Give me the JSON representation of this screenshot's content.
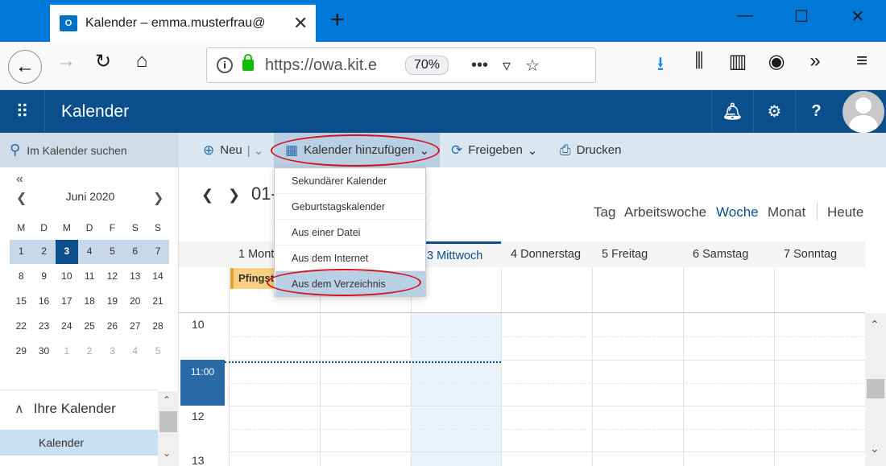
{
  "browser": {
    "tab_title": "Kalender – emma.musterfrau@",
    "favicon_text": "O",
    "url": "https://owa.kit.e",
    "zoom": "70%"
  },
  "app": {
    "title": "Kalender",
    "search_placeholder": "Im Kalender suchen"
  },
  "toolbar": {
    "new_label": "Neu",
    "add_calendar_label": "Kalender hinzufügen",
    "share_label": "Freigeben",
    "print_label": "Drucken"
  },
  "dropdown": {
    "items": [
      "Sekundärer Kalender",
      "Geburtstagskalender",
      "Aus einer Datei",
      "Aus dem Internet",
      "Aus dem Verzeichnis"
    ]
  },
  "mini_calendar": {
    "month": "Juni 2020",
    "weekday_headers": [
      "M",
      "D",
      "M",
      "D",
      "F",
      "S",
      "S"
    ],
    "rows": [
      [
        "1",
        "2",
        "3",
        "4",
        "5",
        "6",
        "7"
      ],
      [
        "8",
        "9",
        "10",
        "11",
        "12",
        "13",
        "14"
      ],
      [
        "15",
        "16",
        "17",
        "18",
        "19",
        "20",
        "21"
      ],
      [
        "22",
        "23",
        "24",
        "25",
        "26",
        "27",
        "28"
      ],
      [
        "29",
        "30",
        "1",
        "2",
        "3",
        "4",
        "5"
      ]
    ]
  },
  "sidebar": {
    "section_label": "Ihre Kalender",
    "calendar_item": "Kalender"
  },
  "calendar": {
    "range": "01-",
    "views": [
      "Tag",
      "Arbeitswoche",
      "Woche",
      "Monat",
      "Heute"
    ],
    "days": [
      "1 Mont",
      "3 Mittwoch",
      "4 Donnerstag",
      "5 Freitag",
      "6 Samstag",
      "7 Sonntag"
    ],
    "event": "Pfingst",
    "hours": [
      "10",
      "12",
      "13"
    ],
    "now_time": "11:00"
  },
  "colors": {
    "header": "#0a4f8c",
    "tabbar": "#0078d7",
    "highlight_oval": "#d4101a"
  }
}
